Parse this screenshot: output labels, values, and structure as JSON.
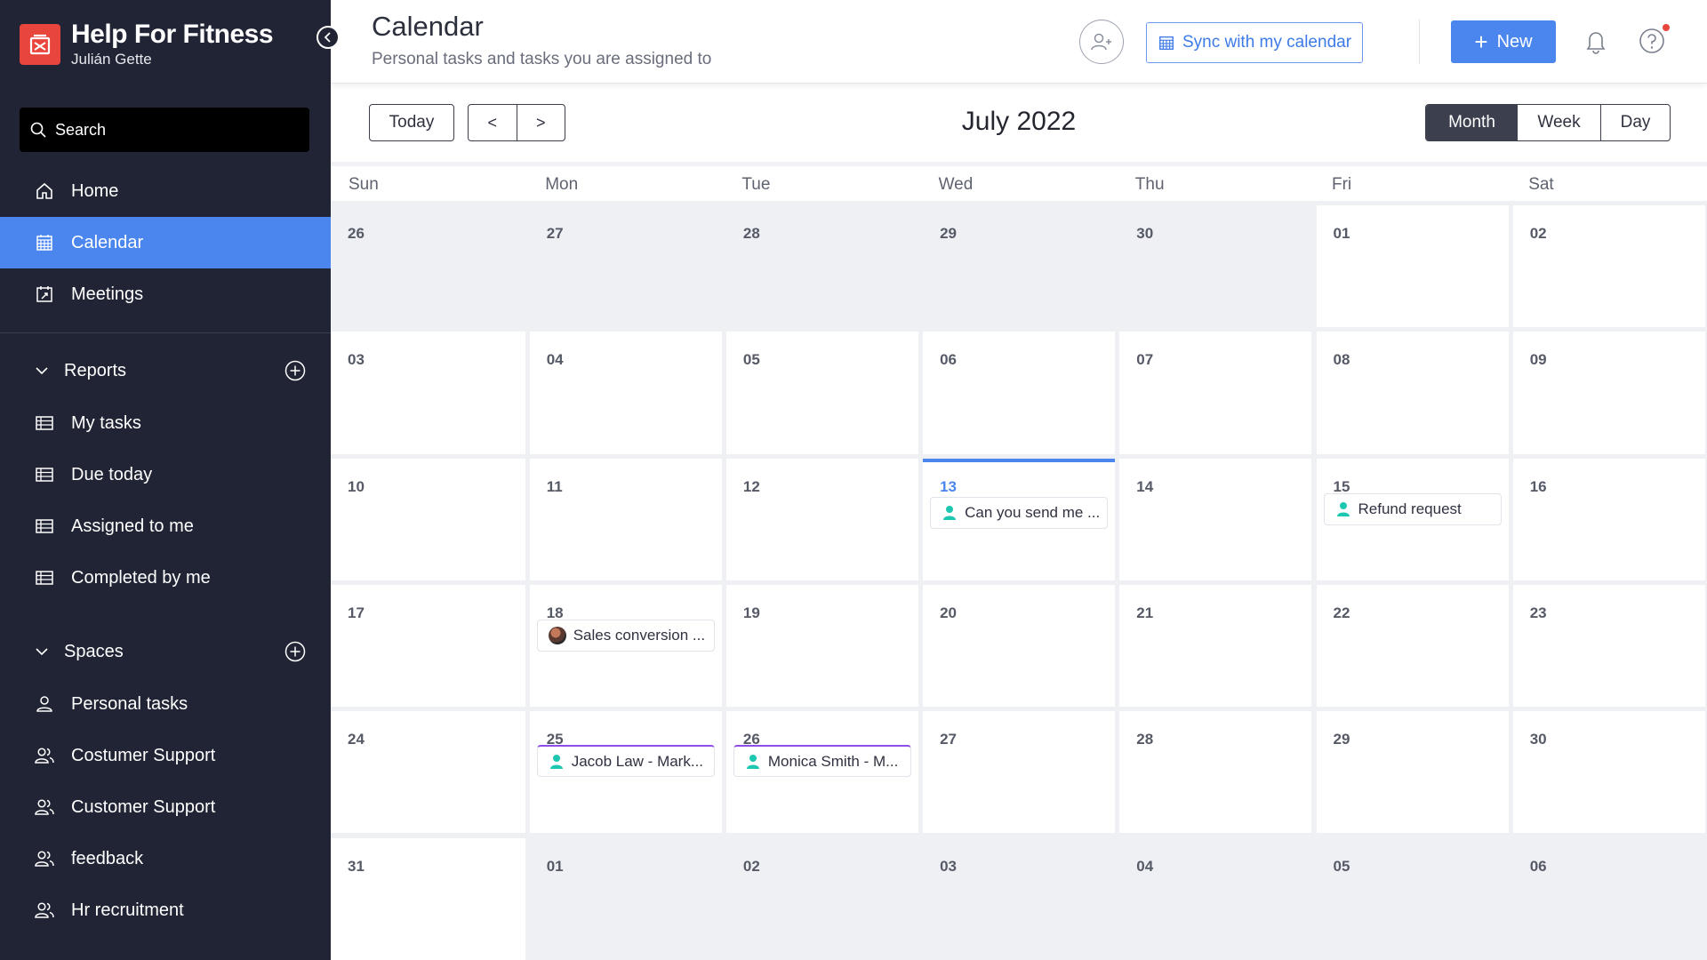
{
  "app": {
    "name": "Help For Fitness",
    "user": "Julián Gette",
    "brand_color": "#e8453c",
    "accent_color": "#4a86ee"
  },
  "sidebar": {
    "search_label": "Search",
    "nav": [
      {
        "label": "Home",
        "icon": "home-icon"
      },
      {
        "label": "Calendar",
        "icon": "calendar-icon",
        "active": true
      },
      {
        "label": "Meetings",
        "icon": "meetings-icon"
      }
    ],
    "reports": {
      "title": "Reports",
      "items": [
        {
          "label": "My tasks",
          "icon": "table-icon"
        },
        {
          "label": "Due today",
          "icon": "table-icon"
        },
        {
          "label": "Assigned to me",
          "icon": "table-icon"
        },
        {
          "label": "Completed by me",
          "icon": "table-icon"
        }
      ]
    },
    "spaces": {
      "title": "Spaces",
      "items": [
        {
          "label": "Personal tasks",
          "icon": "person-icon"
        },
        {
          "label": "Costumer Support",
          "icon": "group-icon"
        },
        {
          "label": "Customer Support",
          "icon": "group-icon"
        },
        {
          "label": "feedback",
          "icon": "group-icon"
        },
        {
          "label": "Hr recruitment",
          "icon": "group-icon"
        }
      ]
    }
  },
  "header": {
    "title": "Calendar",
    "subtitle": "Personal tasks and tasks you are assigned to",
    "sync_label": "Sync with my calendar",
    "new_label": "New"
  },
  "toolbar": {
    "today_label": "Today",
    "prev_label": "<",
    "next_label": ">",
    "month_title": "July 2022",
    "views": {
      "month": "Month",
      "week": "Week",
      "day": "Day"
    },
    "active_view": "Month"
  },
  "calendar": {
    "weekdays": [
      "Sun",
      "Mon",
      "Tue",
      "Wed",
      "Thu",
      "Fri",
      "Sat"
    ],
    "today": "13",
    "weeks": [
      [
        "26",
        "27",
        "28",
        "29",
        "30",
        "01",
        "02"
      ],
      [
        "03",
        "04",
        "05",
        "06",
        "07",
        "08",
        "09"
      ],
      [
        "10",
        "11",
        "12",
        "13",
        "14",
        "15",
        "16"
      ],
      [
        "17",
        "18",
        "19",
        "20",
        "21",
        "22",
        "23"
      ],
      [
        "24",
        "25",
        "26",
        "27",
        "28",
        "29",
        "30"
      ],
      [
        "31",
        "01",
        "02",
        "03",
        "04",
        "05",
        "06"
      ]
    ],
    "events": [
      {
        "week": 2,
        "day": 3,
        "title": "Can you send me ...",
        "icon": "person-icon",
        "style": "plain"
      },
      {
        "week": 2,
        "day": 5,
        "title": "Refund request",
        "icon": "person-icon",
        "style": "plain"
      },
      {
        "week": 3,
        "day": 1,
        "title": "Sales conversion ...",
        "icon": "avatar",
        "style": "plain"
      },
      {
        "week": 4,
        "day": 1,
        "title": "Jacob Law - Mark...",
        "icon": "person-icon",
        "style": "purple"
      },
      {
        "week": 4,
        "day": 2,
        "title": "Monica Smith - M...",
        "icon": "person-icon",
        "style": "purple"
      }
    ]
  }
}
